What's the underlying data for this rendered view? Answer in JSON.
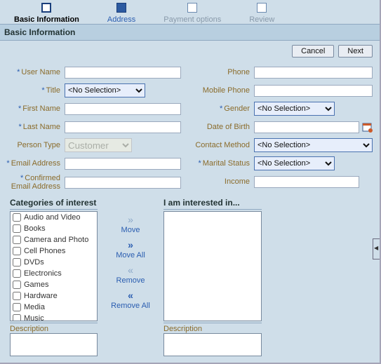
{
  "train": {
    "steps": [
      {
        "label": "Basic Information",
        "state": "current"
      },
      {
        "label": "Address",
        "state": "link"
      },
      {
        "label": "Payment options",
        "state": "future"
      },
      {
        "label": "Review",
        "state": "future"
      }
    ]
  },
  "heading": "Basic Information",
  "buttons": {
    "cancel": "Cancel",
    "next": "Next"
  },
  "left_fields": {
    "user_name": {
      "label": "User Name",
      "required": true,
      "value": ""
    },
    "title": {
      "label": "Title",
      "required": true,
      "value": "<No Selection>"
    },
    "first_name": {
      "label": "First Name",
      "required": true,
      "value": ""
    },
    "last_name": {
      "label": "Last Name",
      "required": true,
      "value": ""
    },
    "person_type": {
      "label": "Person Type",
      "value": "Customer"
    },
    "email": {
      "label": "Email Address",
      "required": true,
      "value": ""
    },
    "confirm_email": {
      "label": "Confirmed Email Address",
      "required": true,
      "value": ""
    }
  },
  "right_fields": {
    "phone": {
      "label": "Phone",
      "value": ""
    },
    "mobile": {
      "label": "Mobile Phone",
      "value": ""
    },
    "gender": {
      "label": "Gender",
      "required": true,
      "value": "<No Selection>"
    },
    "dob": {
      "label": "Date of Birth",
      "value": ""
    },
    "contact": {
      "label": "Contact Method",
      "value": "<No Selection>"
    },
    "marital": {
      "label": "Marital Status",
      "required": true,
      "value": "<No Selection>"
    },
    "income": {
      "label": "Income",
      "value": ""
    }
  },
  "shuttle": {
    "left_title": "Categories of interest",
    "right_title": "I am interested in...",
    "items": [
      "Audio and Video",
      "Books",
      "Camera and Photo",
      "Cell Phones",
      "DVDs",
      "Electronics",
      "Games",
      "Hardware",
      "Media",
      "Music"
    ],
    "buttons": {
      "move": "Move",
      "move_all": "Move All",
      "remove": "Remove",
      "remove_all": "Remove All"
    },
    "description_label": "Description"
  }
}
